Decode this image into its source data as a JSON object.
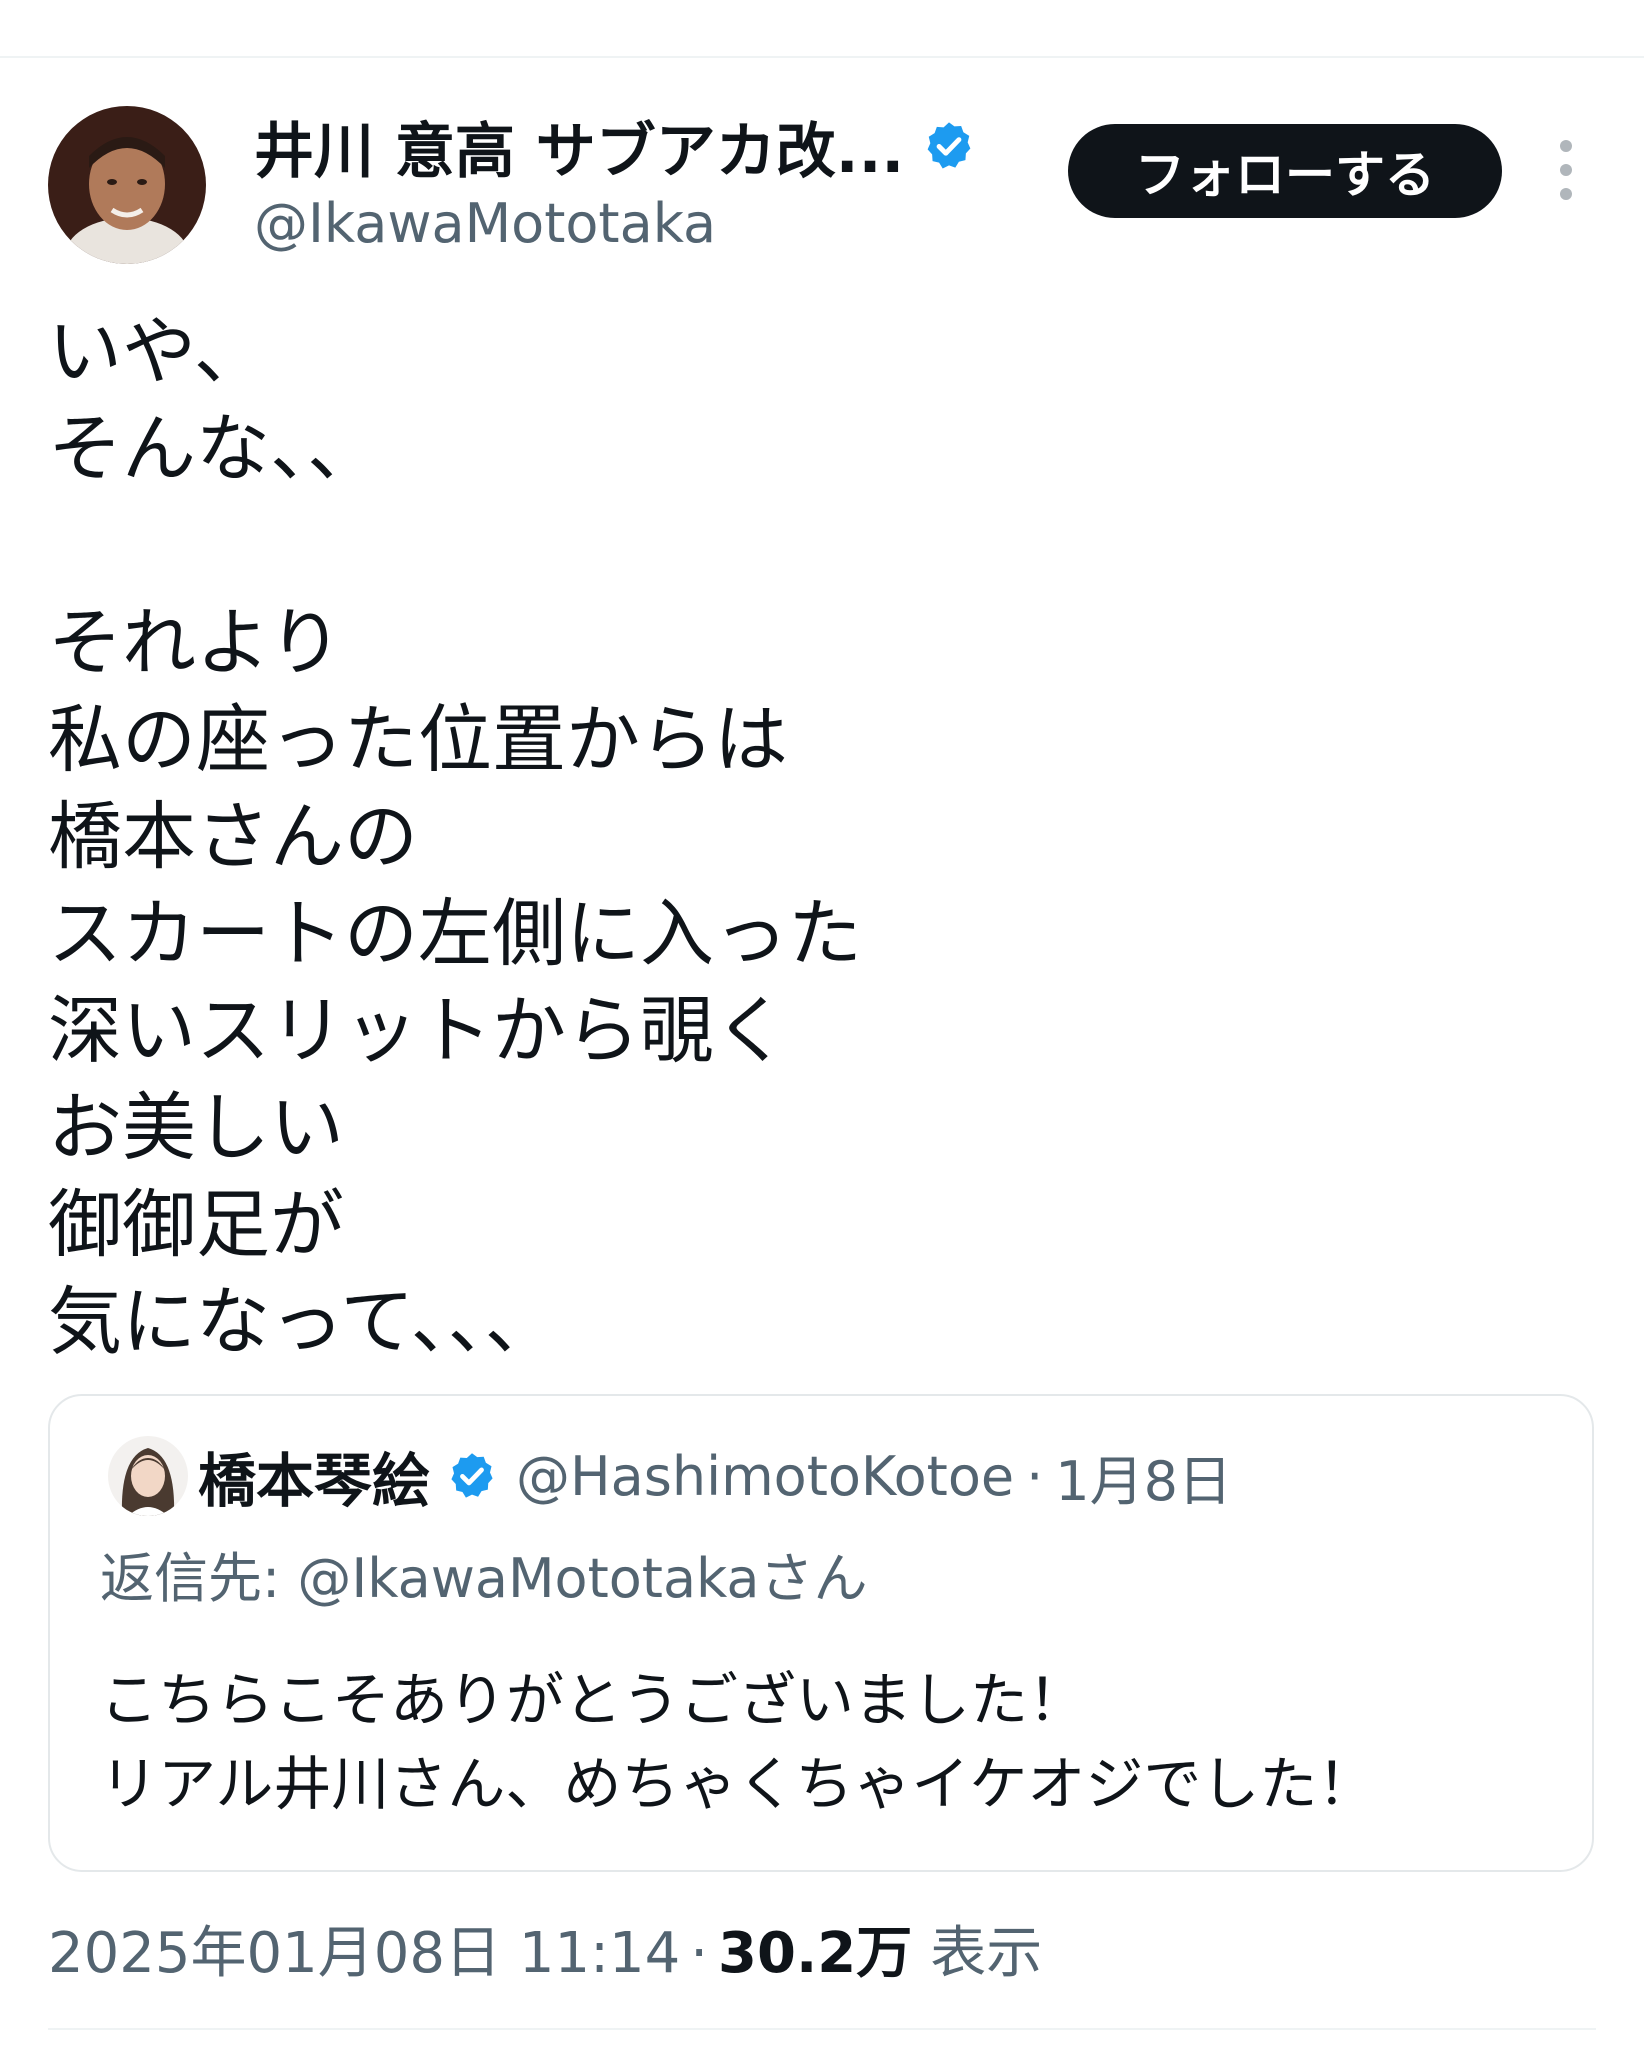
{
  "author": {
    "display_name": "井川 意高 サブアカ改...",
    "handle": "@IkawaMototaka"
  },
  "follow_button_label": "フォローする",
  "tweet_lines": [
    "いや、",
    "そんな、、",
    "",
    "それより",
    "私の座った位置からは",
    "橋本さんの",
    "スカートの左側に入った",
    "深いスリットから覗く",
    "お美しい",
    "御御足が",
    "気になって、、、"
  ],
  "quote": {
    "display_name": "橋本琴絵",
    "handle": "@HashimotoKotoe",
    "separator": "·",
    "date": "1月8日",
    "reply_prefix": "返信先: ",
    "reply_mention": "@IkawaMototakaさん",
    "lines": [
      "こちらこそありがとうございました！",
      "リアル井川さん、めちゃくちゃイケオジでした！"
    ]
  },
  "meta": {
    "timestamp": "2025年01月08日 11:14",
    "separator": "·",
    "views_count": "30.2万",
    "views_label": "表示"
  },
  "colors": {
    "text_primary": "#0f1419",
    "text_secondary": "#536471",
    "verified_blue": "#1d9bf0",
    "button_bg": "#0f1419"
  },
  "icons": {
    "verified": "verified-badge-icon",
    "more": "more-vertical-icon"
  }
}
